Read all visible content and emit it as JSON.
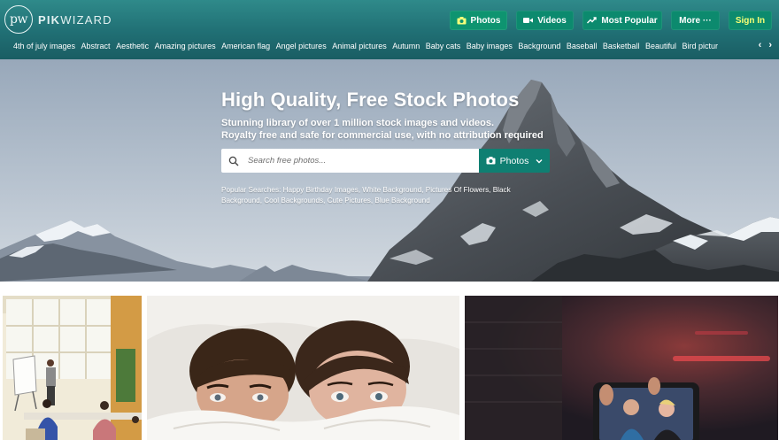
{
  "brand": {
    "logo_mark": "pw",
    "logo_text_bold": "PIK",
    "logo_text_rest": "WIZARD"
  },
  "nav": {
    "photos": "Photos",
    "videos": "Videos",
    "most_popular": "Most Popular",
    "more": "More ···",
    "sign_in": "Sign In"
  },
  "categories": [
    "4th of july images",
    "Abstract",
    "Aesthetic",
    "Amazing pictures",
    "American flag",
    "Angel pictures",
    "Animal pictures",
    "Autumn",
    "Baby cats",
    "Baby images",
    "Background",
    "Baseball",
    "Basketball",
    "Beautiful",
    "Bird pictur"
  ],
  "category_arrows": {
    "prev": "‹",
    "next": "›"
  },
  "hero": {
    "title": "High Quality, Free Stock Photos",
    "subtitle_line1": "Stunning library of over 1 million stock images and videos.",
    "subtitle_line2": "Royalty free and safe for commercial use, with no attribution required",
    "search_placeholder": "Search free photos...",
    "search_type": "Photos",
    "popular_label": "Popular Searches:",
    "popular_searches": "Happy Birthday Images, White Background, Pictures Of Flowers, Black Background, Cool Backgrounds, Cute Pictures, Blue Background"
  },
  "icons": {
    "nav_photos": "camera-icon",
    "nav_videos": "video-camera-icon",
    "nav_popular": "trending-icon",
    "search": "search-icon",
    "search_type": "camera-icon",
    "dropdown": "chevron-down-icon"
  },
  "colors": {
    "header_top": "#2f8a8a",
    "header_bottom": "#1a5d63",
    "nav_button": "#0c8a6e",
    "accent_yellow": "#f6ff75",
    "search_dropdown": "#0f7f72"
  }
}
